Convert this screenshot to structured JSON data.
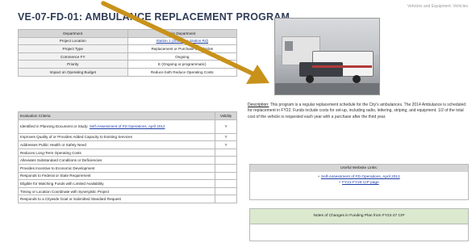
{
  "header": {
    "right_text": "Vehicles and Equipment: Vehicles",
    "title": "VE-07-FD-01:  AMBULANCE REPLACEMENT PROGRAM"
  },
  "info_table": {
    "col1": "Department",
    "col2": "Fire Department",
    "rows": [
      {
        "label": "Project Location",
        "value": "Station 1 (2015 Fire Station Rd)",
        "link": true
      },
      {
        "label": "Project Type",
        "value": "Replacement or Purchase of Vehicles",
        "link": false
      },
      {
        "label": "Commence FY",
        "value": "Ongoing",
        "link": false
      },
      {
        "label": "Priority",
        "value": "E (Ongoing or programmatic)",
        "link": false
      },
      {
        "label": "Impact on Operating Budget",
        "value": "Reduce both Reduce Operating Costs",
        "link": false
      }
    ]
  },
  "evaluation": {
    "header_criteria": "Evaluation Criteria",
    "header_validity": "Validity",
    "rows": [
      {
        "prefix": "Identified in Planning Document or Study:",
        "link": "Self-Assessment of FD Operations, April 2012",
        "mark": "Y"
      },
      {
        "text": "Improves Quality of or Provides Added Capacity to Existing Services",
        "mark": "Y"
      },
      {
        "text": "Addresses Public Health or Safety Need",
        "mark": "Y"
      },
      {
        "text": "Reduces Long-Term Operating Costs",
        "mark": ""
      },
      {
        "text": "Alleviates Substandard Conditions or Deficiencies",
        "mark": ""
      },
      {
        "text": "Provides Incentive to Economic Development",
        "mark": ""
      },
      {
        "text": "Responds to Federal or State Requirement",
        "mark": ""
      },
      {
        "text": "Eligible for Matching Funds with Limited Availability",
        "mark": ""
      },
      {
        "text": "Timing or Location Coordinate with Synergistic Project",
        "mark": ""
      },
      {
        "text": "Responds to a Citywide Goal or Submitted Standard Request",
        "mark": ""
      }
    ]
  },
  "photo": {
    "icon": "ambulance-photo"
  },
  "description": {
    "label": "Description:",
    "text": " This program is a regular replacement schedule for the City's ambulances. The 2014 Ambulance is scheduled for replacement in FY22. Funds include costs for set-up, including radio, lettering, striping, and equipment. 1/2 of the total cost of the vehicle is requested each year with a purchase after the third year."
  },
  "useful_links": {
    "title": "Useful Website Links:",
    "items": [
      "Self-Assessment of FD Operations, April 2012",
      "FY21-FY26 CIP page"
    ]
  },
  "notes": {
    "title": "Notes of Changes in Funding Plan from FY22-27 CIP"
  },
  "colors": {
    "title": "#2f3d57",
    "arrow": "#c8921a",
    "link": "#1f3fa6",
    "notes_header": "#dbe9cf"
  }
}
